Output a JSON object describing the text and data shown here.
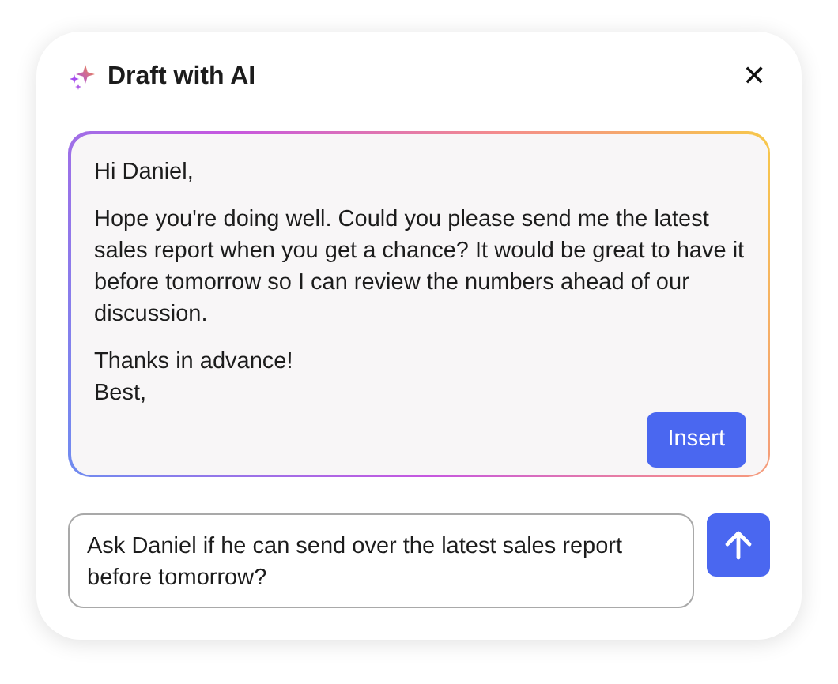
{
  "dialog": {
    "title": "Draft with AI",
    "close": "✕"
  },
  "draft": {
    "greeting": "Hi Daniel,",
    "body": "Hope you're doing well. Could you please send me the latest sales report when you get a chance? It would be great to have it before tomorrow so I can review the numbers ahead of our discussion.",
    "closing": [
      "Thanks in advance!",
      "Best,"
    ],
    "insert_button": "Insert"
  },
  "prompt": {
    "value": "Ask Daniel if he can send over the latest sales report before tomorrow?"
  }
}
